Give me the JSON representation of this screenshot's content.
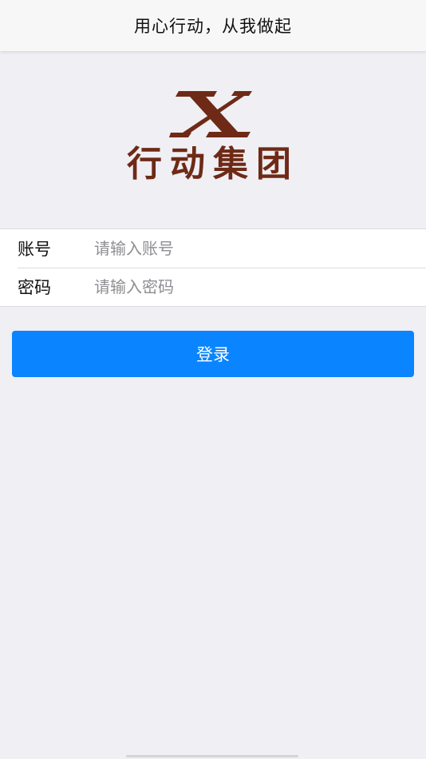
{
  "header": {
    "title": "用心行动，从我做起"
  },
  "logo": {
    "mark_icon": "x-logo-icon",
    "text": "行动集团",
    "color": "#6e2a16"
  },
  "form": {
    "account": {
      "label": "账号",
      "placeholder": "请输入账号",
      "value": ""
    },
    "password": {
      "label": "密码",
      "placeholder": "请输入密码",
      "value": ""
    }
  },
  "login_button": {
    "label": "登录",
    "color": "#0a84ff"
  },
  "colors": {
    "background": "#efeff4",
    "nav_background": "#f7f7f7",
    "placeholder": "#8e8e93"
  }
}
